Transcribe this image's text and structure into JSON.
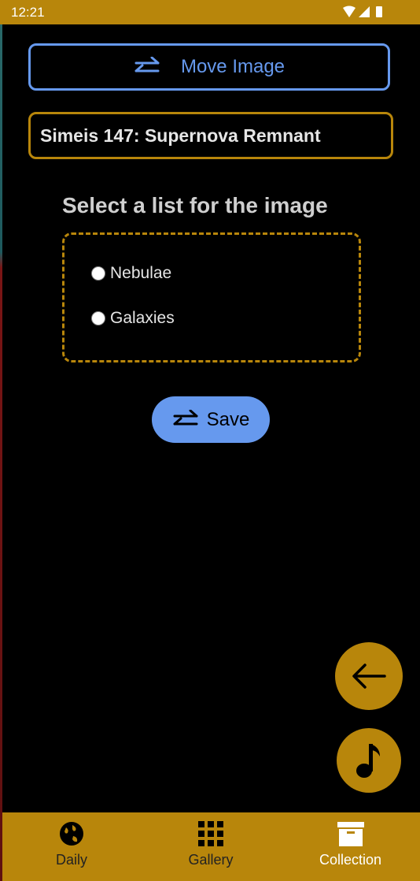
{
  "status_bar": {
    "time": "12:21"
  },
  "header": {
    "title": "Move Image",
    "icon": "swap-horizontal-icon"
  },
  "image": {
    "name": "Simeis 147: Supernova Remnant"
  },
  "list_selector": {
    "prompt": "Select a list for the image",
    "options": [
      {
        "label": "Nebulae",
        "selected": false
      },
      {
        "label": "Galaxies",
        "selected": false
      }
    ]
  },
  "save_button": {
    "label": "Save",
    "icon": "swap-horizontal-icon"
  },
  "fabs": {
    "back": "arrow-left-icon",
    "music": "music-note-icon"
  },
  "bottom_nav": {
    "active": "Collection",
    "items": [
      {
        "label": "Daily",
        "icon": "globe-icon"
      },
      {
        "label": "Gallery",
        "icon": "grid-icon"
      },
      {
        "label": "Collection",
        "icon": "archive-box-icon"
      }
    ]
  },
  "colors": {
    "accent_gold": "#b8860b",
    "accent_blue": "#6699ee",
    "background": "#000000"
  }
}
